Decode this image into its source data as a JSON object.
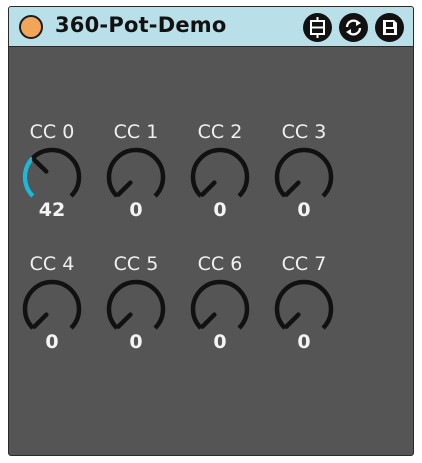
{
  "window": {
    "title": "360-Pot-Demo",
    "accent_color": "#b9dfe9",
    "status_dot_color": "#f3a557",
    "toolbar_icons": [
      "freeze-icon",
      "refresh-icon",
      "save-icon"
    ]
  },
  "knobs": [
    {
      "label": "CC 0",
      "value": "42",
      "fraction": 0.33
    },
    {
      "label": "CC 1",
      "value": "0",
      "fraction": 0
    },
    {
      "label": "CC 2",
      "value": "0",
      "fraction": 0
    },
    {
      "label": "CC 3",
      "value": "0",
      "fraction": 0
    },
    {
      "label": "CC 4",
      "value": "0",
      "fraction": 0
    },
    {
      "label": "CC 5",
      "value": "0",
      "fraction": 0
    },
    {
      "label": "CC 6",
      "value": "0",
      "fraction": 0
    },
    {
      "label": "CC 7",
      "value": "0",
      "fraction": 0
    }
  ],
  "colors": {
    "panel": "#555555",
    "knob_track": "#111111",
    "knob_active": "#1fb7d6",
    "text": "#f0f0f0"
  }
}
